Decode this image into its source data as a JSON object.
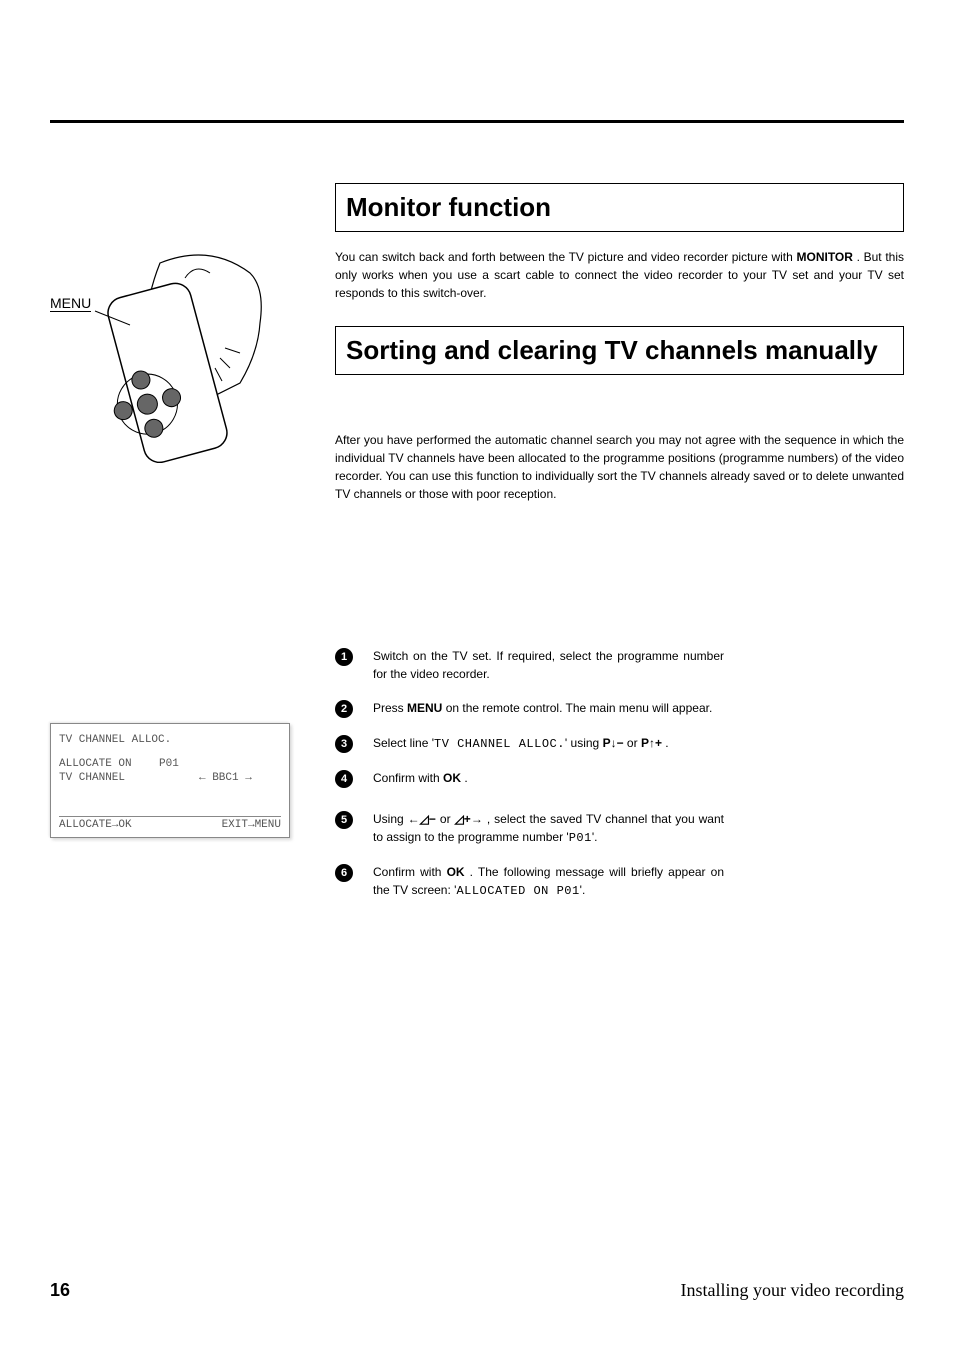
{
  "rule": "",
  "section1": {
    "title": "Monitor function",
    "para_pre": "You can switch back and forth between the TV picture and video recorder picture with ",
    "para_bold": "MONITOR",
    "para_post": " . But this only works when you use a scart cable to connect the video recorder to your TV set and your TV set responds to this switch-over."
  },
  "section2": {
    "title": "Sorting and clearing TV channels manually",
    "para": "After you have performed the automatic channel search you may not agree with the sequence in which the individual TV channels have been allocated to the programme positions (programme numbers) of the video recorder. You can use this function to individually sort the TV channels already saved or to delete unwanted TV channels or those with poor reception."
  },
  "steps": [
    {
      "n": "1",
      "t": "Switch on the TV set. If required, select the programme number for the video recorder."
    },
    {
      "n": "2",
      "pre": "Press ",
      "b": "MENU",
      "post": " on the remote control. The main menu will appear."
    },
    {
      "n": "3",
      "pre": "Select line '",
      "mono": "TV CHANNEL ALLOC.",
      "mid": "' using ",
      "k1": "P↓−",
      "or": " or ",
      "k2": "P↑+",
      "post": " ."
    },
    {
      "n": "4",
      "pre": "Confirm with ",
      "b": "OK",
      "post": " ."
    },
    {
      "n": "5",
      "pre": "Using ",
      "k1": "←◿−",
      "or": " or ",
      "k2": "◿+→",
      "mid": " , select the saved TV channel that you want to assign to the programme number '",
      "mono": "P01",
      "post": "'."
    },
    {
      "n": "6",
      "pre": "Confirm with ",
      "b": "OK",
      "mid": " . The following message will briefly appear on the TV screen: '",
      "mono": "ALLOCATED ON P01",
      "post": "'."
    }
  ],
  "remote": {
    "label": "MENU"
  },
  "osd": {
    "title": "TV CHANNEL ALLOC.",
    "row1_label": "ALLOCATE ON",
    "row1_val": "P01",
    "row2_label": "TV CHANNEL",
    "row2_val": "← BBC1  →",
    "footer_left": "ALLOCATE→OK",
    "footer_right": "EXIT→MENU"
  },
  "footer": {
    "page": "16",
    "title": "Installing your video recording"
  }
}
